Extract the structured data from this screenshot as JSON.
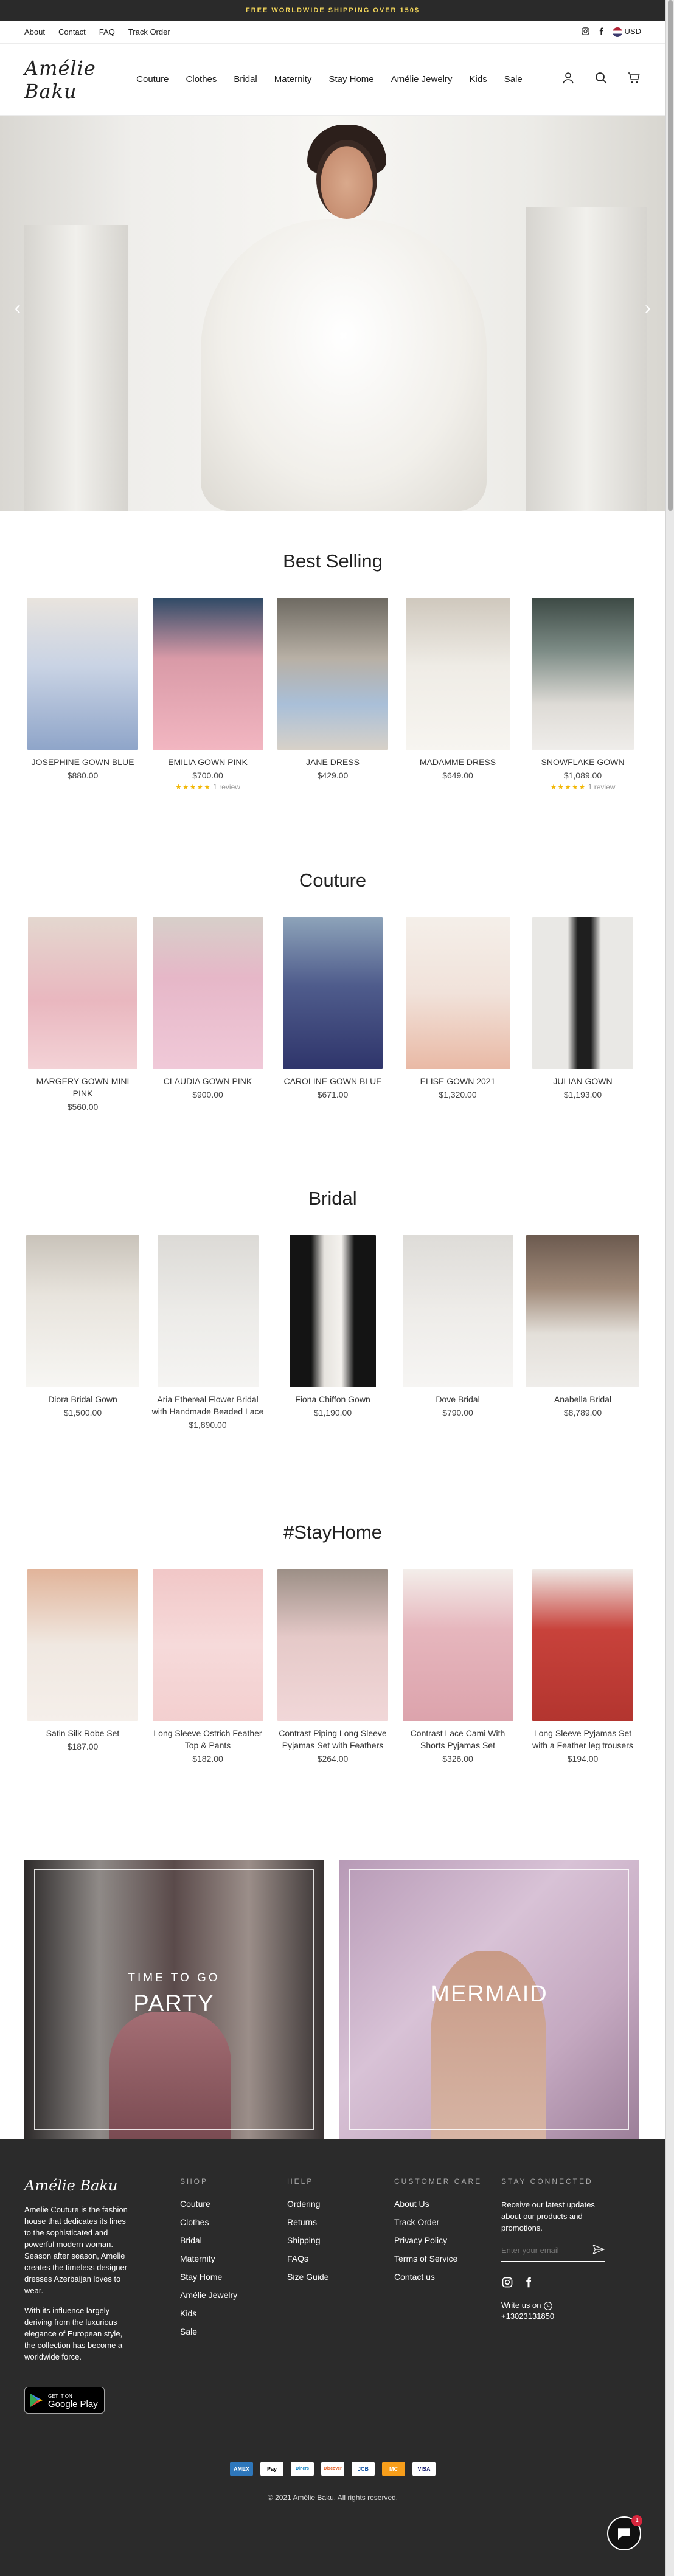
{
  "announcement": "FREE WORLDWIDE SHIPPING OVER 150$",
  "utility": {
    "links": [
      "About",
      "Contact",
      "FAQ",
      "Track Order"
    ],
    "currency": "USD"
  },
  "header": {
    "logo": "Amélie Baku",
    "nav": [
      "Couture",
      "Clothes",
      "Bridal",
      "Maternity",
      "Stay Home",
      "Amélie Jewelry",
      "Kids",
      "Sale"
    ]
  },
  "sections": {
    "best_selling": {
      "title": "Best Selling",
      "products": [
        {
          "name": "JOSEPHINE GOWN BLUE",
          "price": "$880.00"
        },
        {
          "name": "EMILIA GOWN PINK",
          "price": "$700.00",
          "reviews": "1 review"
        },
        {
          "name": "JANE DRESS",
          "price": "$429.00"
        },
        {
          "name": "MADAMME DRESS",
          "price": "$649.00"
        },
        {
          "name": "SNOWFLAKE GOWN",
          "price": "$1,089.00",
          "reviews": "1 review"
        }
      ]
    },
    "couture": {
      "title": "Couture",
      "products": [
        {
          "name": "MARGERY GOWN MINI PINK",
          "price": "$560.00"
        },
        {
          "name": "CLAUDIA GOWN PINK",
          "price": "$900.00"
        },
        {
          "name": "CAROLINE GOWN BLUE",
          "price": "$671.00"
        },
        {
          "name": "ELISE GOWN 2021",
          "price": "$1,320.00"
        },
        {
          "name": "JULIAN GOWN",
          "price": "$1,193.00"
        }
      ]
    },
    "bridal": {
      "title": "Bridal",
      "products": [
        {
          "name": "Diora Bridal Gown",
          "price": "$1,500.00"
        },
        {
          "name": "Aria Ethereal Flower Bridal with Handmade Beaded Lace",
          "price": "$1,890.00"
        },
        {
          "name": "Fiona Chiffon Gown",
          "price": "$1,190.00"
        },
        {
          "name": "Dove Bridal",
          "price": "$790.00"
        },
        {
          "name": "Anabella Bridal",
          "price": "$8,789.00"
        }
      ]
    },
    "stayhome": {
      "title": "#StayHome",
      "products": [
        {
          "name": "Satin Silk Robe Set",
          "price": "$187.00"
        },
        {
          "name": "Long Sleeve Ostrich Feather Top & Pants",
          "price": "$182.00"
        },
        {
          "name": "Contrast Piping Long Sleeve Pyjamas Set with Feathers",
          "price": "$264.00"
        },
        {
          "name": "Contrast Lace Cami With Shorts Pyjamas Set",
          "price": "$326.00"
        },
        {
          "name": "Long Sleeve Pyjamas Set with a Feather leg trousers",
          "price": "$194.00"
        }
      ]
    }
  },
  "promos": {
    "party": {
      "subtitle": "TIME TO GO",
      "title": "PARTY"
    },
    "mermaid": {
      "title": "MERMAID"
    }
  },
  "footer": {
    "logo": "Amélie Baku",
    "about": "Amelie Couture is the fashion house that dedicates its lines to the sophisticated and powerful modern woman. Season after season, Amelie creates the timeless designer dresses Azerbaijan loves to wear.",
    "about2": "With its influence largely deriving from the luxurious elegance of European style, the collection has become a worldwide force.",
    "google_play_small": "GET IT ON",
    "google_play": "Google Play",
    "shop_head": "SHOP",
    "shop": [
      "Couture",
      "Clothes",
      "Bridal",
      "Maternity",
      "Stay Home",
      "Amélie Jewelry",
      "Kids",
      "Sale"
    ],
    "help_head": "HELP",
    "help": [
      "Ordering",
      "Returns",
      "Shipping",
      "FAQs",
      "Size Guide"
    ],
    "care_head": "CUSTOMER CARE",
    "care": [
      "About Us",
      "Track Order",
      "Privacy Policy",
      "Terms of Service",
      "Contact us"
    ],
    "connect_head": "STAY CONNECTED",
    "connect_text": "Receive our latest updates about our products and promotions.",
    "email_placeholder": "Enter your email",
    "write_us": "Write us on",
    "phone": "+13023131850",
    "payments": [
      "AMEX",
      "Pay",
      "Diners",
      "Discover",
      "JCB",
      "MC",
      "VISA"
    ],
    "copyright": "© 2021 Amélie Baku. All rights reserved."
  },
  "chat": {
    "badge": "1"
  },
  "colors": {
    "announce_bg": "#2a2a2a",
    "announce_text": "#f3d65a",
    "footer_bg": "#2b2b2b",
    "star": "#f2b705",
    "chat_badge": "#d7263d"
  }
}
